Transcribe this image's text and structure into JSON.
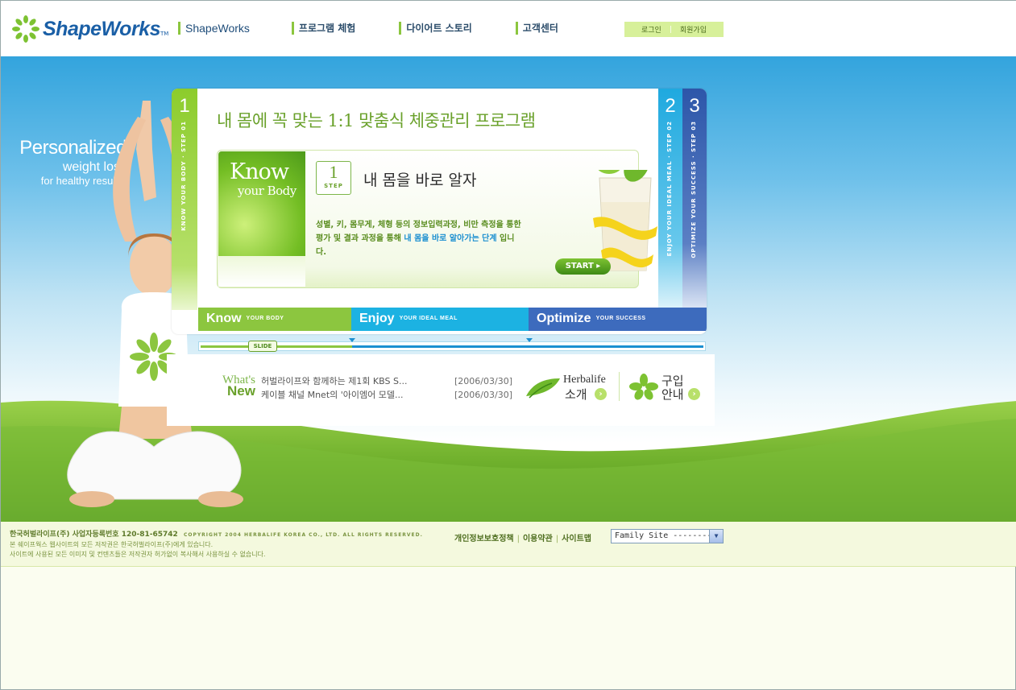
{
  "header": {
    "logo_text": "ShapeWorks",
    "logo_tm": "TM",
    "nav": [
      "ShapeWorks",
      "프로그램 체험",
      "다이어트 스토리",
      "고객센터"
    ],
    "login": "로그인",
    "signup": "회원가입"
  },
  "hero": {
    "tagline": {
      "line1": "Personalized",
      "line2": "weight loss",
      "line3": "for healthy results."
    },
    "title": "내 몸에 꼭 맞는 1:1 맞춤식 체중관리 프로그램",
    "steps": [
      {
        "num": "1",
        "label": "KNOW YOUR BODY · STEP 01"
      },
      {
        "num": "2",
        "label": "ENJOY YOUR IDEAL MEAL · STEP 02"
      },
      {
        "num": "3",
        "label": "OPTIMIZE YOUR SUCCESS · STEP 03"
      }
    ],
    "card": {
      "know_line1": "Know",
      "know_line2": "your Body",
      "badge_num": "1",
      "badge_label": "STEP",
      "heading": "내 몸을 바로 알자",
      "desc_part1": "성별, 키, 몸무게, 체형 등의 정보입력과정, 비만 측정을 통한 평가 및 결과 과정을 통해 ",
      "desc_highlight": "내 몸을 바로 알아가는 단계",
      "desc_part2": " 입니다.",
      "start": "START"
    },
    "tabs": [
      {
        "main": "Know",
        "sub": "YOUR BODY"
      },
      {
        "main": "Enjoy",
        "sub": "YOUR IDEAL MEAL"
      },
      {
        "main": "Optimize",
        "sub": "YOUR SUCCESS"
      }
    ],
    "slide_label": "SLIDE"
  },
  "news": {
    "whats": "What's",
    "new": "New",
    "items": [
      {
        "title": "허벌라이프와 함께하는 제1회 KBS S...",
        "date": "[2006/03/30]"
      },
      {
        "title": "케이블 채널 Mnet의 '아이엠어 모델...",
        "date": "[2006/03/30]"
      }
    ],
    "promo1": {
      "en": "Herbalife",
      "ko": "소개"
    },
    "promo2": {
      "ko1": "구입",
      "ko2": "안내"
    }
  },
  "footer": {
    "company": "한국허벌라이프(주) 사업자등록번호 120-81-65742",
    "copyright": "COPYRIGHT 2004 HERBALIFE KOREA CO., LTD. ALL RIGHTS RESERVED.",
    "line2": "본 쉐이프웍스 웹사이트의 모든 저작권은 한국허벌라이프(주)에게 있습니다.",
    "line3": "사이트에 사용된 모든 이미지 및 컨텐츠들은 저작권자 허가없이 복사해서 사용하실 수 없습니다.",
    "links": [
      "개인정보보호정책",
      "이용약관",
      "사이트맵"
    ],
    "family_site": "Family Site --------"
  },
  "colors": {
    "green": "#8cc63f",
    "blue": "#1cb2e2",
    "navy": "#3d6bbd"
  }
}
